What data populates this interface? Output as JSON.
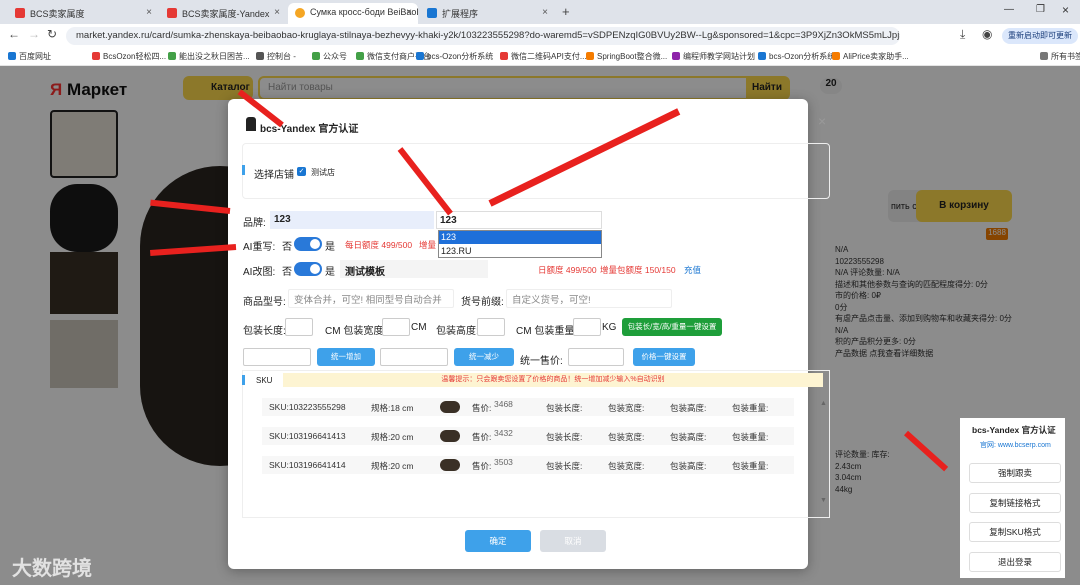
{
  "tabs": [
    {
      "title": "BCS卖家属度",
      "color": "#e53935"
    },
    {
      "title": "BCS卖家属度-Yandex",
      "color": "#e53935"
    },
    {
      "title": "Сумка кросс-боди BeiBaoBa",
      "color": "#f5a623"
    },
    {
      "title": "扩展程序",
      "color": "#1976d2"
    }
  ],
  "url": "market.yandex.ru/card/sumka-zhenskaya-beibaobao-kruglaya-stilnaya-bezhevyy-khaki-y2k/103223555298?do-waremd5=vSDPENzqIG0BVUy2BW--Lg&sponsored=1&cpc=3P9XjZn3OkMS5mLJpjstnLUM...",
  "update_label": "重新启动即可更新",
  "bookmarks": [
    "百度网址",
    "BcsOzon轻松四...",
    "能出没之秋日困苦...",
    "控制台 -",
    "公众号",
    "微信支付商户平台",
    "bcs-Ozon分析系统",
    "微信二维码API支付...",
    "SpringBoot整合微...",
    "编程师教学网站计划",
    "bcs-Ozon分析系统",
    "AliPrice卖家助手...",
    "所有书签"
  ],
  "market": {
    "logo": "Маркет",
    "catalog": "Каталог",
    "search_placeholder": "Найти товары",
    "search_btn": "Найти",
    "cart_btn": "В корзину",
    "buy_now": "пить сейчас",
    "badge": "1688",
    "count": "20"
  },
  "modal": {
    "title": "bcs-Yandex 官方认证",
    "close": "×",
    "shop_label": "选择店铺",
    "shop_value": "测试店",
    "brand_label": "品牌:",
    "brand_value": "123",
    "brand_search": "123",
    "brand_options": [
      "123",
      "123.RU"
    ],
    "ai_rewrite_label": "AI重写:",
    "no": "否",
    "yes": "是",
    "daily_quota": "每日额度 499/500",
    "inc_quota_short": "增量",
    "ai_image_label": "AI改图:",
    "template": "测试模板",
    "quota2": "日额度 499/500",
    "inc_quota2": "增量包额度 150/150",
    "recharge": "充值",
    "model_label": "商品型号:",
    "model_placeholder": "变体合并，可空! 相同型号自动合并",
    "prefix_label": "货号前缀:",
    "prefix_placeholder": "自定义货号，可空!",
    "len_label": "包装长度:",
    "width_label": "CM 包装宽度:",
    "cm": "CM",
    "height_label": "包装高度:",
    "weight_label": "CM 包装重量:",
    "kg": "KG",
    "set_all_btn": "包装长/宽/高/重量一键设置",
    "inc_btn": "统一增加",
    "dec_btn": "统一减少",
    "price_label": "统一售价:",
    "price_btn": "价格一键设置",
    "sku_label": "SKU",
    "tip": "温馨提示：只会跟卖您设置了价格的商品！统一增加减少输入%自动识别",
    "skus": [
      {
        "id": "SKU:103223555298",
        "spec": "规格:18 cm",
        "price": "3468"
      },
      {
        "id": "SKU:103196641413",
        "spec": "规格:20 cm",
        "price": "3432"
      },
      {
        "id": "SKU:103196641414",
        "spec": "规格:20 cm",
        "price": "3503"
      }
    ],
    "price_col": "售价:",
    "col_len": "包装长度:",
    "col_w": "包装宽度:",
    "col_h": "包装高度:",
    "col_wt": "包装重量:",
    "ok": "确定",
    "cancel": "取消"
  },
  "side": {
    "title": "bcs-Yandex 官方认证",
    "site": "官网: www.bcserp.com",
    "btns": [
      "强制跟卖",
      "复制链接格式",
      "复制SKU格式",
      "退出登录"
    ]
  },
  "bg_texts": [
    "N/A",
    "102235552​98",
    "N/A 评论数量: N/A",
    "描述和其他参数与查询的匹配程度得分: 0分",
    "市的价格: 0₽",
    "0分",
    "有虐产品点击量、添加到购物车和收藏夹得分: 0分",
    "N/A",
    "积的产品积分更多: 0分",
    "产品数据 点我查看详细数据",
    "评论数量: 库存:",
    "2.43cm",
    "3.04cm",
    "44kg"
  ],
  "watermark": "大数跨境",
  "colors": {
    "accent": "#3ea1ea",
    "green": "#1e9e3a",
    "red": "#e53935",
    "yellow": "#ffdb4d"
  }
}
